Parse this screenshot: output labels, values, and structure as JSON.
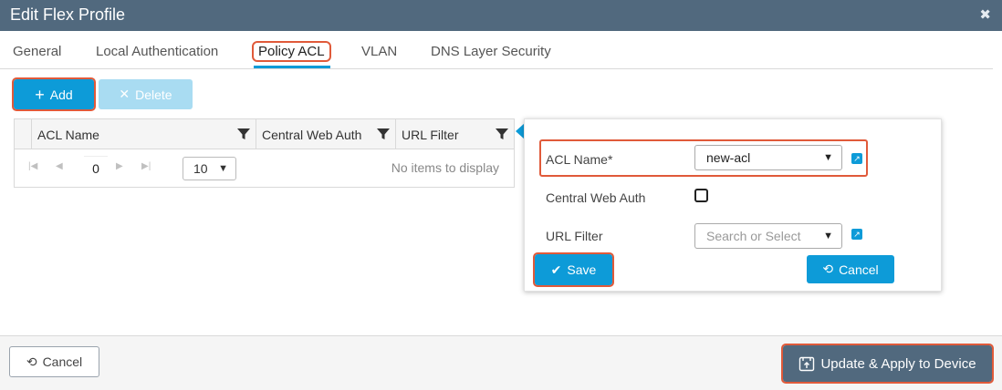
{
  "window": {
    "title": "Edit Flex Profile",
    "close_glyph": "✖"
  },
  "tabs": [
    {
      "label": "General"
    },
    {
      "label": "Local Authentication"
    },
    {
      "label": "Policy ACL",
      "active": true
    },
    {
      "label": "VLAN"
    },
    {
      "label": "DNS Layer Security"
    }
  ],
  "toolbar": {
    "add_label": "Add",
    "delete_label": "Delete"
  },
  "grid": {
    "columns": [
      "ACL Name",
      "Central Web Auth",
      "URL Filter"
    ],
    "current_page": "0",
    "page_size": "10",
    "empty_text": "No items to display"
  },
  "form": {
    "acl_name_label": "ACL Name*",
    "acl_name_value": "new-acl",
    "cwa_label": "Central Web Auth",
    "cwa_checked": false,
    "url_filter_label": "URL Filter",
    "url_filter_placeholder": "Search or Select",
    "save_label": "Save",
    "cancel_label": "Cancel"
  },
  "footer": {
    "cancel_label": "Cancel",
    "update_label": "Update & Apply to Device"
  },
  "colors": {
    "header": "#51697e",
    "accent": "#0d9bd8",
    "highlight": "#e05a3a"
  },
  "icons": [
    "close-icon",
    "plus-icon",
    "x-icon",
    "filter-icon",
    "first-page-icon",
    "prev-page-icon",
    "next-page-icon",
    "last-page-icon",
    "chevron-down-icon",
    "external-link-icon",
    "checkmark-icon",
    "undo-icon",
    "device-apply-icon"
  ]
}
